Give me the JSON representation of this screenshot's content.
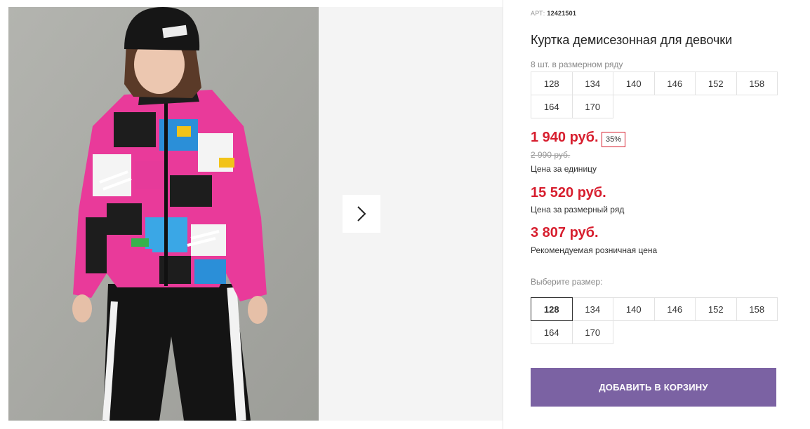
{
  "product": {
    "sku_label": "АРТ:",
    "sku": "12421501",
    "title": "Куртка демисезонная для девочки",
    "pack_label": "8 шт. в размерном ряду",
    "pack_sizes": [
      "128",
      "134",
      "140",
      "146",
      "152",
      "158",
      "164",
      "170"
    ]
  },
  "pricing": {
    "unit_price": "1 940 руб.",
    "discount": "35%",
    "old_price": "2 990 руб.",
    "unit_caption": "Цена за единицу",
    "pack_price": "15 520 руб.",
    "pack_caption": "Цена за размерный ряд",
    "rrp_price": "3 807 руб.",
    "rrp_caption": "Рекомендуемая розничная цена"
  },
  "size_picker": {
    "label": "Выберите размер:",
    "options": [
      "128",
      "134",
      "140",
      "146",
      "152",
      "158",
      "164",
      "170"
    ],
    "selected": "128"
  },
  "cart": {
    "add_label": "ДОБАВИТЬ В КОРЗИНУ"
  },
  "gallery": {
    "next_icon": "chevron-right-icon"
  },
  "colors": {
    "price_red": "#d71e2e",
    "button_purple": "#7b62a3",
    "photo_background": "#a9aaa5",
    "gallery_background": "#f4f4f4"
  }
}
